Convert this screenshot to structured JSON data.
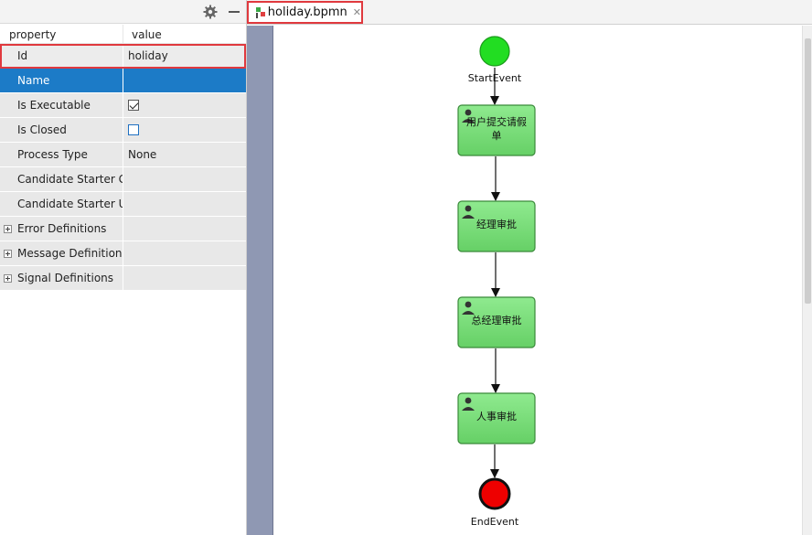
{
  "left_panel": {
    "headers": {
      "property": "property",
      "value": "value"
    },
    "rows": [
      {
        "name": "Id",
        "value": "holiday"
      },
      {
        "name": "Name",
        "value": ""
      },
      {
        "name": "Is Executable",
        "value": "checked"
      },
      {
        "name": "Is Closed",
        "value": "unchecked"
      },
      {
        "name": "Process Type",
        "value": "None"
      },
      {
        "name": "Candidate Starter G",
        "value": ""
      },
      {
        "name": "Candidate Starter U",
        "value": ""
      },
      {
        "name": "Error Definitions",
        "value": ""
      },
      {
        "name": "Message Definitions",
        "value": ""
      },
      {
        "name": "Signal Definitions",
        "value": ""
      }
    ]
  },
  "tab": {
    "label": "holiday.bpmn",
    "close": "✕"
  },
  "diagram": {
    "start_label": "StartEvent",
    "end_label": "EndEvent",
    "tasks": [
      {
        "line1": "用户提交请假",
        "line2": "单"
      },
      {
        "line1": "经理审批",
        "line2": ""
      },
      {
        "line1": "总经理审批",
        "line2": ""
      },
      {
        "line1": "人事审批",
        "line2": ""
      }
    ],
    "colors": {
      "start": "#22dd22",
      "end": "#ee0000",
      "task_fill": "#7fe07f",
      "task_stroke": "#3a8a3a"
    }
  }
}
